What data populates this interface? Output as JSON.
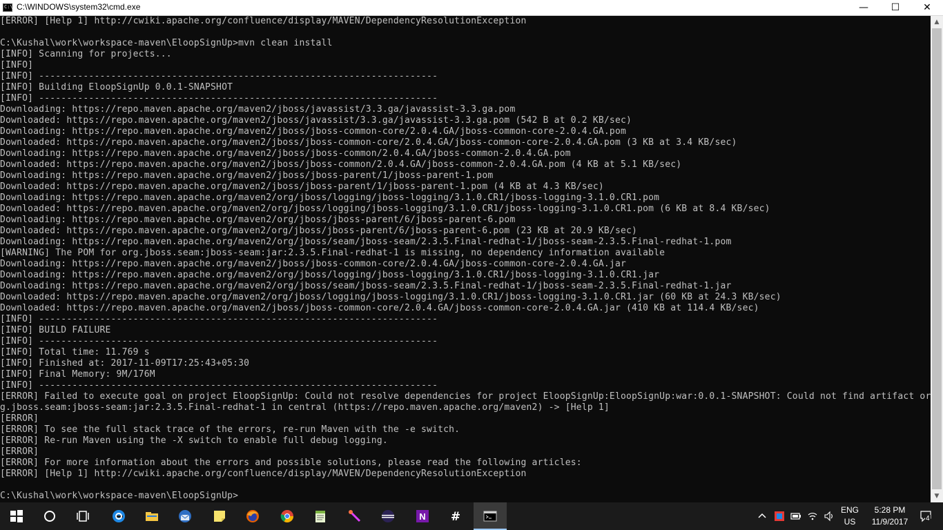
{
  "window": {
    "title": "C:\\WINDOWS\\system32\\cmd.exe",
    "icon": "cmd-icon",
    "controls": {
      "minimize": "—",
      "maximize": "☐",
      "close": "✕"
    }
  },
  "console": {
    "lines": [
      "[ERROR] [Help 1] http://cwiki.apache.org/confluence/display/MAVEN/DependencyResolutionException",
      "",
      "C:\\Kushal\\work\\workspace-maven\\EloopSignUp>mvn clean install",
      "[INFO] Scanning for projects...",
      "[INFO]",
      "[INFO] ------------------------------------------------------------------------",
      "[INFO] Building EloopSignUp 0.0.1-SNAPSHOT",
      "[INFO] ------------------------------------------------------------------------",
      "Downloading: https://repo.maven.apache.org/maven2/jboss/javassist/3.3.ga/javassist-3.3.ga.pom",
      "Downloaded: https://repo.maven.apache.org/maven2/jboss/javassist/3.3.ga/javassist-3.3.ga.pom (542 B at 0.2 KB/sec)",
      "Downloading: https://repo.maven.apache.org/maven2/jboss/jboss-common-core/2.0.4.GA/jboss-common-core-2.0.4.GA.pom",
      "Downloaded: https://repo.maven.apache.org/maven2/jboss/jboss-common-core/2.0.4.GA/jboss-common-core-2.0.4.GA.pom (3 KB at 3.4 KB/sec)",
      "Downloading: https://repo.maven.apache.org/maven2/jboss/jboss-common/2.0.4.GA/jboss-common-2.0.4.GA.pom",
      "Downloaded: https://repo.maven.apache.org/maven2/jboss/jboss-common/2.0.4.GA/jboss-common-2.0.4.GA.pom (4 KB at 5.1 KB/sec)",
      "Downloading: https://repo.maven.apache.org/maven2/jboss/jboss-parent/1/jboss-parent-1.pom",
      "Downloaded: https://repo.maven.apache.org/maven2/jboss/jboss-parent/1/jboss-parent-1.pom (4 KB at 4.3 KB/sec)",
      "Downloading: https://repo.maven.apache.org/maven2/org/jboss/logging/jboss-logging/3.1.0.CR1/jboss-logging-3.1.0.CR1.pom",
      "Downloaded: https://repo.maven.apache.org/maven2/org/jboss/logging/jboss-logging/3.1.0.CR1/jboss-logging-3.1.0.CR1.pom (6 KB at 8.4 KB/sec)",
      "Downloading: https://repo.maven.apache.org/maven2/org/jboss/jboss-parent/6/jboss-parent-6.pom",
      "Downloaded: https://repo.maven.apache.org/maven2/org/jboss/jboss-parent/6/jboss-parent-6.pom (23 KB at 20.9 KB/sec)",
      "Downloading: https://repo.maven.apache.org/maven2/org/jboss/seam/jboss-seam/2.3.5.Final-redhat-1/jboss-seam-2.3.5.Final-redhat-1.pom",
      "[WARNING] The POM for org.jboss.seam:jboss-seam:jar:2.3.5.Final-redhat-1 is missing, no dependency information available",
      "Downloading: https://repo.maven.apache.org/maven2/jboss/jboss-common-core/2.0.4.GA/jboss-common-core-2.0.4.GA.jar",
      "Downloading: https://repo.maven.apache.org/maven2/org/jboss/logging/jboss-logging/3.1.0.CR1/jboss-logging-3.1.0.CR1.jar",
      "Downloading: https://repo.maven.apache.org/maven2/org/jboss/seam/jboss-seam/2.3.5.Final-redhat-1/jboss-seam-2.3.5.Final-redhat-1.jar",
      "Downloaded: https://repo.maven.apache.org/maven2/org/jboss/logging/jboss-logging/3.1.0.CR1/jboss-logging-3.1.0.CR1.jar (60 KB at 24.3 KB/sec)",
      "Downloaded: https://repo.maven.apache.org/maven2/jboss/jboss-common-core/2.0.4.GA/jboss-common-core-2.0.4.GA.jar (410 KB at 114.4 KB/sec)",
      "[INFO] ------------------------------------------------------------------------",
      "[INFO] BUILD FAILURE",
      "[INFO] ------------------------------------------------------------------------",
      "[INFO] Total time: 11.769 s",
      "[INFO] Finished at: 2017-11-09T17:25:43+05:30",
      "[INFO] Final Memory: 9M/176M",
      "[INFO] ------------------------------------------------------------------------",
      "[ERROR] Failed to execute goal on project EloopSignUp: Could not resolve dependencies for project EloopSignUp:EloopSignUp:war:0.0.1-SNAPSHOT: Could not find artifact or",
      "g.jboss.seam:jboss-seam:jar:2.3.5.Final-redhat-1 in central (https://repo.maven.apache.org/maven2) -> [Help 1]",
      "[ERROR]",
      "[ERROR] To see the full stack trace of the errors, re-run Maven with the -e switch.",
      "[ERROR] Re-run Maven using the -X switch to enable full debug logging.",
      "[ERROR]",
      "[ERROR] For more information about the errors and possible solutions, please read the following articles:",
      "[ERROR] [Help 1] http://cwiki.apache.org/confluence/display/MAVEN/DependencyResolutionException",
      "",
      "C:\\Kushal\\work\\workspace-maven\\EloopSignUp>"
    ]
  },
  "scrollbar": {
    "up": "▲",
    "down": "▼"
  },
  "taskbar": {
    "apps": [
      {
        "name": "start-button",
        "icon": "windows-logo-icon"
      },
      {
        "name": "cortana-button",
        "icon": "search-circle-icon"
      },
      {
        "name": "task-view-button",
        "icon": "task-view-icon"
      },
      {
        "name": "edge-button",
        "icon": "edge-icon"
      },
      {
        "name": "file-explorer-button",
        "icon": "folder-icon"
      },
      {
        "name": "thunderbird-button",
        "icon": "thunderbird-icon"
      },
      {
        "name": "sticky-notes-button",
        "icon": "sticky-note-icon"
      },
      {
        "name": "firefox-button",
        "icon": "firefox-icon"
      },
      {
        "name": "chrome-button",
        "icon": "chrome-icon"
      },
      {
        "name": "notepad-plus-button",
        "icon": "notepad-plus-icon"
      },
      {
        "name": "tool-button",
        "icon": "wand-icon"
      },
      {
        "name": "eclipse-button",
        "icon": "eclipse-icon"
      },
      {
        "name": "onenote-button",
        "icon": "onenote-icon"
      },
      {
        "name": "slack-button",
        "icon": "slack-icon"
      },
      {
        "name": "cmd-button",
        "icon": "cmd-icon"
      }
    ],
    "tray": {
      "language": "ENG",
      "region": "US",
      "time": "5:28 PM",
      "date": "11/9/2017",
      "notifications": "4"
    }
  },
  "colors": {
    "console_bg": "#0c0c0c",
    "console_fg": "#c0c0c0",
    "taskbar_bg": "#1b1b1b",
    "active_app_bg": "#3a3a3a"
  }
}
